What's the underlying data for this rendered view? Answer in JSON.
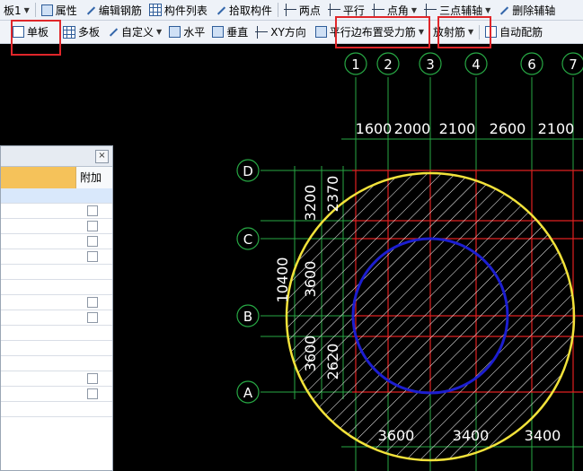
{
  "toolbar1": {
    "board_select": "板1",
    "property": "属性",
    "edit_rebar": "编辑钢筋",
    "component_list": "构件列表",
    "pick_component": "拾取构件",
    "two_points": "两点",
    "parallel": "平行",
    "point_angle": "点角",
    "three_point_axis": "三点辅轴",
    "delete_axis": "删除辅轴"
  },
  "toolbar2": {
    "single_board": "单板",
    "multi_board": "多板",
    "custom": "自定义",
    "horizontal": "水平",
    "vertical": "垂直",
    "xy_direction": "XY方向",
    "parallel_edge": "平行边布置受力筋",
    "radial": "放射筋",
    "auto_rebar": "自动配筋"
  },
  "panel": {
    "close_label": "×",
    "column_extra": "附加",
    "rows": [
      {
        "checkbox": false,
        "selected": true
      },
      {
        "checkbox": true
      },
      {
        "checkbox": true
      },
      {
        "checkbox": true
      },
      {
        "checkbox": true
      },
      {
        "checkbox": false
      },
      {
        "checkbox": false
      },
      {
        "checkbox": true
      },
      {
        "checkbox": true
      },
      {
        "checkbox": false
      },
      {
        "checkbox": false
      },
      {
        "checkbox": false
      },
      {
        "checkbox": true
      },
      {
        "checkbox": true
      },
      {
        "checkbox": false
      }
    ]
  },
  "drawing": {
    "column_axes": [
      "1",
      "2",
      "3",
      "4",
      "6",
      "7"
    ],
    "row_axes": [
      "D",
      "C",
      "B",
      "A"
    ],
    "top_dims": [
      "1600",
      "2000",
      "2100",
      "2600",
      "2100"
    ],
    "bottom_dims": [
      "3600",
      "3400",
      "3400"
    ],
    "left_total": "10400",
    "left_dims_outer": [
      "3200",
      "3600",
      "3600"
    ],
    "left_dims_inner": [
      "2370",
      "2620"
    ],
    "colors": {
      "background": "#000000",
      "axis_lines": "#27a844",
      "beam_lines": "#e02020",
      "outer_circle": "#f2e23a",
      "inner_circle": "#1c1ed0",
      "highlight_box": "#e0262a"
    }
  }
}
